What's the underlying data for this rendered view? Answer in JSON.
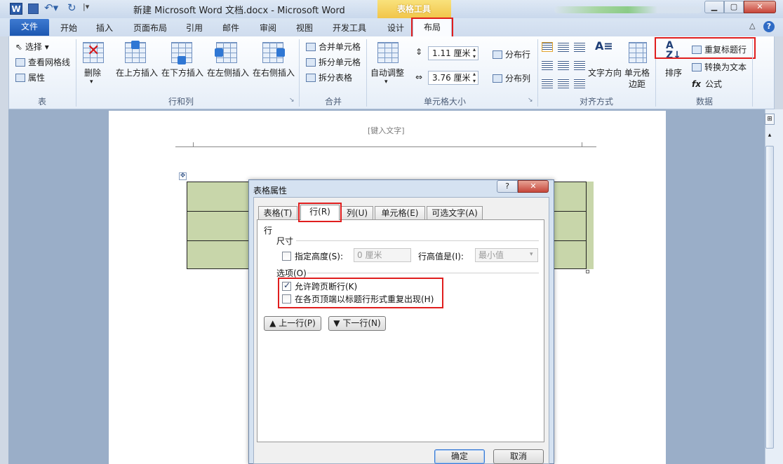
{
  "title_bar": {
    "app_icon": "W",
    "doc_title": "新建 Microsoft Word 文档.docx  -  Microsoft Word",
    "contextual_group": "表格工具",
    "icons": [
      "word-icon",
      "save-icon",
      "undo-icon",
      "redo-icon",
      "minimize-icon",
      "maximize-icon",
      "close-icon"
    ]
  },
  "tabs": {
    "file": "文件",
    "home": "开始",
    "insert": "插入",
    "page_layout": "页面布局",
    "references": "引用",
    "mailings": "邮件",
    "review": "审阅",
    "view": "视图",
    "developer": "开发工具",
    "design": "设计",
    "layout": "布局"
  },
  "ribbon": {
    "table_group": {
      "label": "表",
      "select": "选择",
      "view_gridlines": "查看网格线",
      "properties": "属性"
    },
    "rows_cols_group": {
      "label": "行和列",
      "delete": "删除",
      "insert_above": "在上方插入",
      "insert_below": "在下方插入",
      "insert_left": "在左侧插入",
      "insert_right": "在右侧插入"
    },
    "merge_group": {
      "label": "合并",
      "merge_cells": "合并单元格",
      "split_cells": "拆分单元格",
      "split_table": "拆分表格"
    },
    "cell_size_group": {
      "label": "单元格大小",
      "autofit": "自动调整",
      "height_value": "1.11 厘米",
      "width_value": "3.76 厘米",
      "distribute_rows": "分布行",
      "distribute_cols": "分布列"
    },
    "alignment_group": {
      "label": "对齐方式",
      "text_direction": "文字方向",
      "cell_margins_line1": "单元格",
      "cell_margins_line2": "边距"
    },
    "data_group": {
      "label": "数据",
      "sort": "排序",
      "repeat_header": "重复标题行",
      "convert_to_text": "转换为文本",
      "formula": "公式"
    },
    "colors": {
      "highlight": "#e01e1e",
      "accent": "#2f6bc5"
    }
  },
  "document": {
    "header_placeholder": "[键入文字]",
    "table_fill_color": "#c8d6aa"
  },
  "dialog": {
    "title": "表格属性",
    "help": "?",
    "tabs": [
      "表格(T)",
      "行(R)",
      "列(U)",
      "单元格(E)",
      "可选文字(A)"
    ],
    "active_tab": "行(R)",
    "section_title": "行",
    "size_group": "尺寸",
    "specify_height": "指定高度(S):",
    "height_value": "0 厘米",
    "height_is": "行高值是(I):",
    "height_rule": "最小值",
    "options_group": "选项(O)",
    "allow_break": "允许跨页断行(K)",
    "allow_break_checked": true,
    "repeat_header": "在各页顶端以标题行形式重复出现(H)",
    "repeat_header_checked": false,
    "prev_row": "上一行(P)",
    "next_row": "下一行(N)",
    "ok": "确定",
    "cancel": "取消"
  }
}
